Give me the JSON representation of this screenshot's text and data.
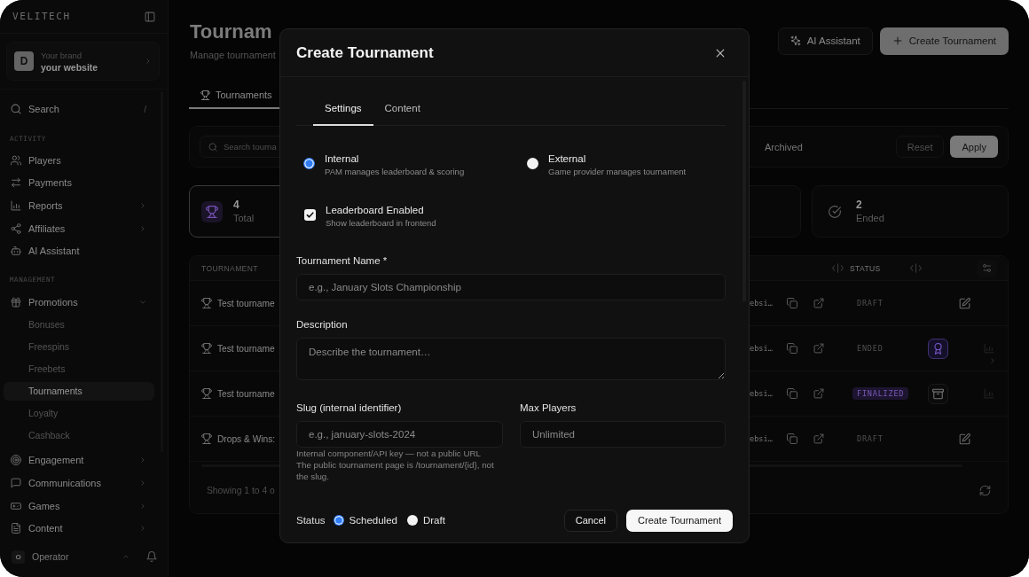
{
  "sidebar": {
    "logo": "VELITECH",
    "brand": {
      "avatar": "D",
      "label": "Your brand",
      "name": "your website"
    },
    "search": {
      "label": "Search",
      "shortcut": "/"
    },
    "sections": [
      {
        "title": "ACTIVITY",
        "items": [
          {
            "label": "Players",
            "selected": false
          },
          {
            "label": "Payments",
            "selected": false
          },
          {
            "label": "Reports",
            "selected": false,
            "expanded": false
          },
          {
            "label": "Affiliates",
            "selected": false,
            "expanded": false
          },
          {
            "label": "AI Assistant",
            "selected": false
          }
        ]
      },
      {
        "title": "MANAGEMENT",
        "items": [
          {
            "label": "Promotions",
            "selected": false,
            "expanded": true,
            "children": [
              {
                "label": "Bonuses",
                "selected": false
              },
              {
                "label": "Freespins",
                "selected": false
              },
              {
                "label": "Freebets",
                "selected": false
              },
              {
                "label": "Tournaments",
                "selected": true
              },
              {
                "label": "Loyalty",
                "selected": false
              },
              {
                "label": "Cashback",
                "selected": false
              }
            ]
          },
          {
            "label": "Engagement",
            "selected": false,
            "expanded": false
          },
          {
            "label": "Communications",
            "selected": false,
            "expanded": false
          },
          {
            "label": "Games",
            "selected": false,
            "expanded": false
          },
          {
            "label": "Content",
            "selected": false,
            "expanded": false
          }
        ]
      }
    ],
    "user": {
      "avatar": "O",
      "name": "Operator"
    }
  },
  "page": {
    "title": "Tournam",
    "subtitle": "Manage tournament",
    "actions": [
      {
        "label": "AI Assistant",
        "kind": "secondary"
      },
      {
        "label": "Create Tournament",
        "kind": "primary"
      }
    ],
    "tabs": [
      {
        "label": "Tournaments",
        "selected": true
      }
    ],
    "filters": {
      "search": {
        "placeholder": "Search tourna"
      },
      "status_tabs": [
        {
          "label": "Archived",
          "selected": false
        }
      ],
      "buttons": [
        {
          "label": "Reset",
          "kind": "ghost"
        },
        {
          "label": "Apply",
          "kind": "primary"
        }
      ]
    },
    "stats": [
      {
        "value": "4",
        "label": "Total",
        "selected": true
      },
      {
        "value": "2",
        "label": "Ended",
        "selected": false
      }
    ],
    "table": {
      "columns": [
        {
          "label": "TOURNAMENT"
        },
        {
          "label": "STATUS"
        }
      ],
      "rows": [
        {
          "name": "Test tourname",
          "site": "ebsi…",
          "status": "DRAFT",
          "kind": "draft"
        },
        {
          "name": "Test tourname",
          "site": "ebsi…",
          "status": "ENDED",
          "kind": "ended"
        },
        {
          "name": "Test tourname",
          "site": "ebsi…",
          "status": "FINALIZED",
          "kind": "finalized"
        },
        {
          "name": "Drops & Wins:",
          "site": "ebsi…",
          "status": "DRAFT",
          "kind": "draft"
        }
      ],
      "summary": "Showing 1 to 4 o"
    }
  },
  "dialog": {
    "title": "Create Tournament",
    "tabs": [
      {
        "label": "Settings",
        "selected": true
      },
      {
        "label": "Content",
        "selected": false
      }
    ],
    "mode_options": [
      {
        "label": "Internal",
        "description": "PAM manages leaderboard & scoring",
        "selected": true
      },
      {
        "label": "External",
        "description": "Game provider manages tournament",
        "selected": false
      }
    ],
    "leaderboard": {
      "label": "Leaderboard Enabled",
      "description": "Show leaderboard in frontend",
      "checked": true
    },
    "fields": [
      {
        "label": "Tournament Name *",
        "placeholder": "e.g., January Slots Championship",
        "kind": "text"
      },
      {
        "label": "Description",
        "placeholder": "Describe the tournament…",
        "kind": "textarea"
      }
    ],
    "field_pair": [
      {
        "label": "Slug (internal identifier)",
        "placeholder": "e.g., january-slots-2024",
        "kind": "text",
        "help": [
          "Internal component/API key — not a public URL",
          "The public tournament page is /tournament/{id}, not the slug."
        ]
      },
      {
        "label": "Max Players",
        "placeholder": "Unlimited",
        "kind": "text"
      }
    ],
    "status": {
      "label": "Status",
      "options": [
        {
          "label": "Scheduled",
          "selected": true
        },
        {
          "label": "Draft",
          "selected": false
        }
      ]
    },
    "buttons": [
      {
        "label": "Cancel",
        "kind": "secondary"
      },
      {
        "label": "Create Tournament",
        "kind": "primary"
      }
    ]
  }
}
